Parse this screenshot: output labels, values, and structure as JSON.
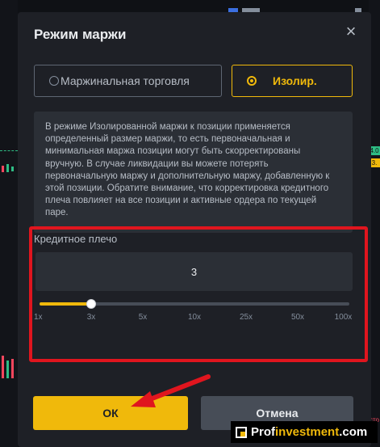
{
  "modal": {
    "title": "Режим маржи",
    "close_icon": "close-icon"
  },
  "margin_mode": {
    "cross_label": "Маржинальная торговля",
    "isolated_label": "Изолир.",
    "selected": "isolated"
  },
  "info_text": "В режиме Изолированной маржи к позиции применяется определенный размер маржи, то есть первоначальная и минимальная маржа позиции могут быть скорректированы вручную. В случае ликвидации вы можете потерять первоначальную маржу и дополнительную маржу, добавленную к этой позиции. Обратите внимание, что корректировка кредитного плеча повлияет на все позиции и активные ордера по текущей паре.",
  "leverage": {
    "label": "Кредитное плечо",
    "value": "3",
    "slider_fraction": 0.167,
    "ticks": [
      "1x",
      "3x",
      "5x",
      "10x",
      "25x",
      "50x",
      "100x"
    ]
  },
  "buttons": {
    "ok_label": "ОК",
    "cancel_label": "Отмена"
  },
  "watermark": {
    "part1": "Prof",
    "part2": "investment",
    "part3": ".com"
  },
  "background": {
    "right_label_1": "4.0",
    "right_label_2": "3.",
    "right_edge_text": "сто"
  },
  "colors": {
    "accent": "#f0b90b",
    "highlight_frame": "#e0151e",
    "modal_bg": "#1e2026",
    "panel_bg": "#2b2f36"
  }
}
